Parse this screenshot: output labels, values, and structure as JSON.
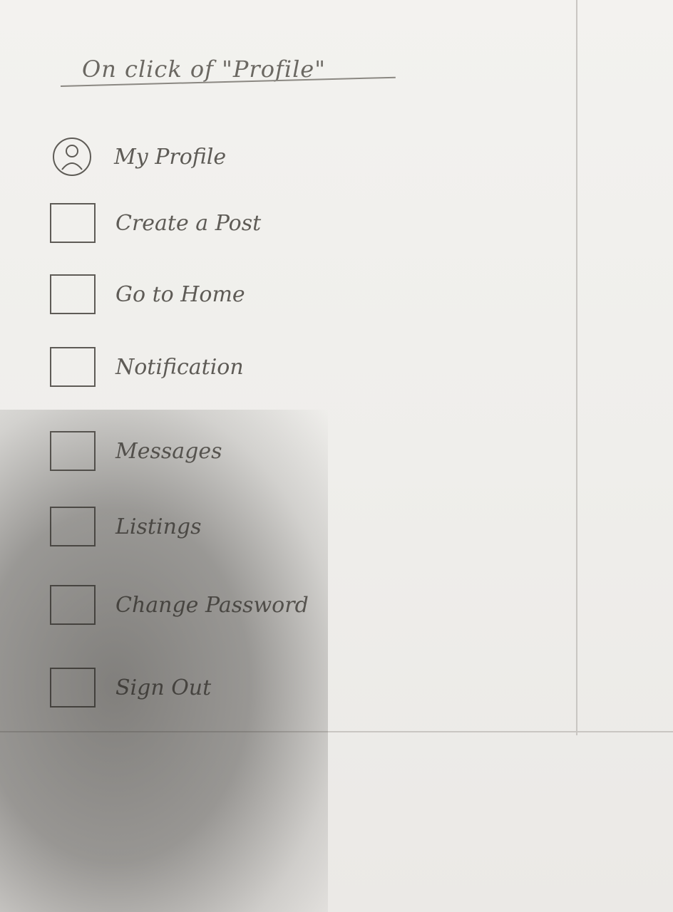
{
  "sketch": {
    "heading": "On click of \"Profile\"",
    "menu": [
      {
        "label": "My Profile",
        "icon": "avatar-icon"
      },
      {
        "label": "Create a Post",
        "icon": "box-icon"
      },
      {
        "label": "Go to Home",
        "icon": "box-icon"
      },
      {
        "label": "Notification",
        "icon": "box-icon"
      },
      {
        "label": "Messages",
        "icon": "box-icon"
      },
      {
        "label": "Listings",
        "icon": "box-icon"
      },
      {
        "label": "Change Password",
        "icon": "box-icon"
      },
      {
        "label": "Sign Out",
        "icon": "box-icon"
      }
    ]
  }
}
